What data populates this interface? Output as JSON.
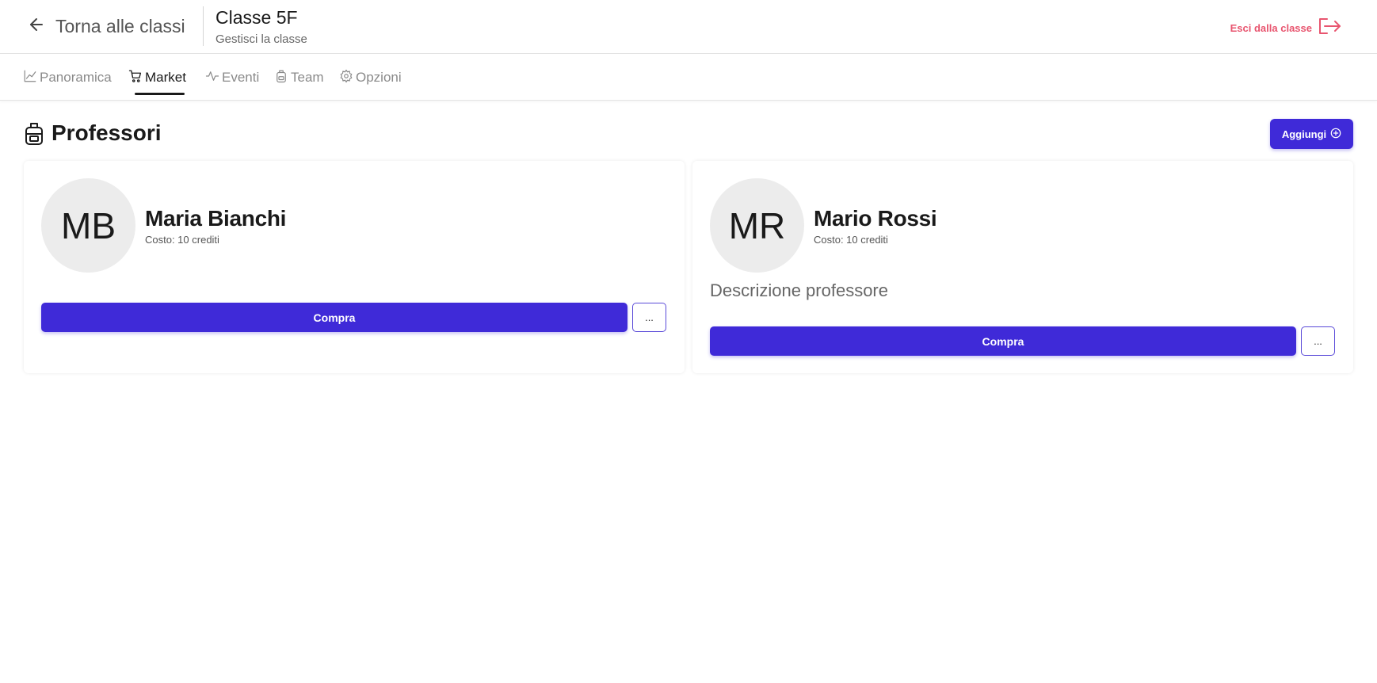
{
  "header": {
    "back_label": "Torna alle classi",
    "class_title": "Classe 5F",
    "class_subtitle": "Gestisci la classe",
    "exit_label": "Esci dalla classe"
  },
  "tabs": [
    {
      "label": "Panoramica",
      "icon": "chart-icon",
      "active": false
    },
    {
      "label": "Market",
      "icon": "cart-icon",
      "active": true
    },
    {
      "label": "Eventi",
      "icon": "activity-icon",
      "active": false
    },
    {
      "label": "Team",
      "icon": "backpack-icon",
      "active": false
    },
    {
      "label": "Opzioni",
      "icon": "gear-icon",
      "active": false
    }
  ],
  "section": {
    "title": "Professori",
    "icon": "backpack-icon",
    "add_label": "Aggiungi"
  },
  "professors": [
    {
      "initials": "MB",
      "name": "Maria Bianchi",
      "cost": "Costo: 10 crediti",
      "description": "",
      "buy_label": "Compra",
      "more_label": "..."
    },
    {
      "initials": "MR",
      "name": "Mario Rossi",
      "cost": "Costo: 10 crediti",
      "description": "Descrizione professore",
      "buy_label": "Compra",
      "more_label": "..."
    }
  ],
  "colors": {
    "accent": "#3f2ad8",
    "exit": "#e8556f"
  }
}
